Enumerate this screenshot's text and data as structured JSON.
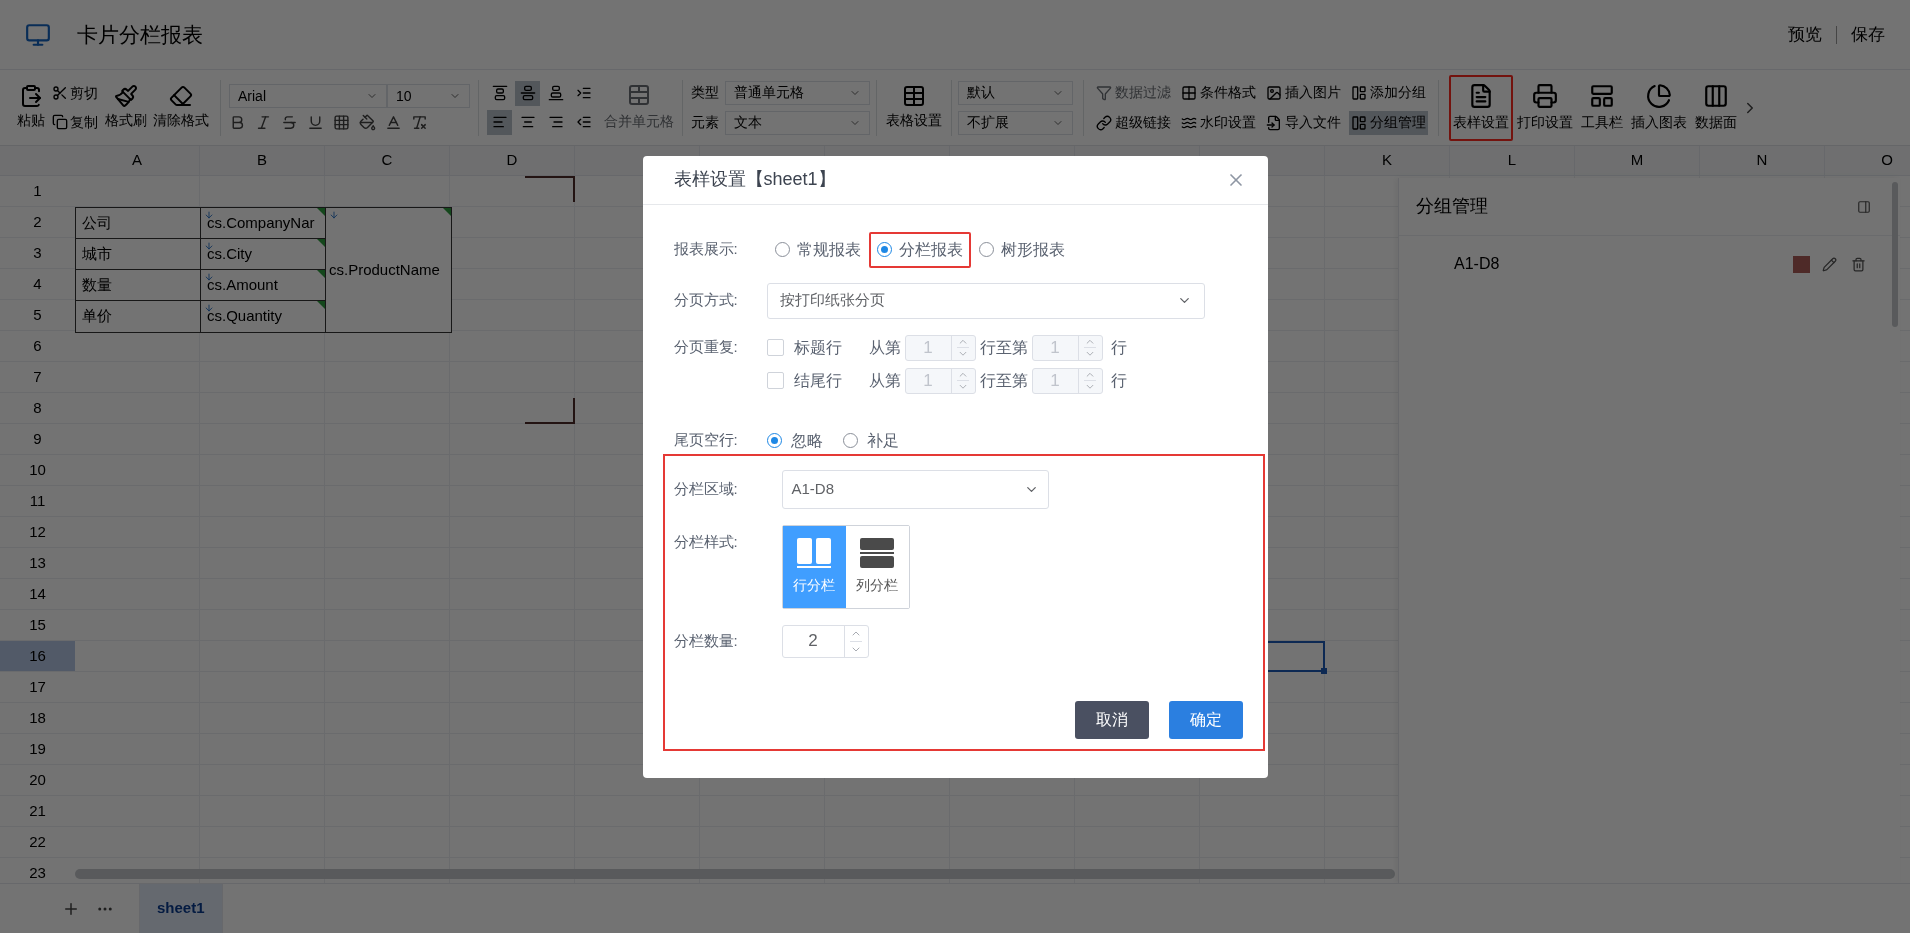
{
  "app": {
    "title": "卡片分栏报表",
    "actions": [
      "预览",
      "保存"
    ]
  },
  "toolbar": {
    "clipboard": {
      "paste": "粘贴",
      "cut": "剪切",
      "copy": "复制",
      "format_painter": "格式刷",
      "clear_format": "清除格式"
    },
    "font": {
      "family": "Arial",
      "size": "10"
    },
    "format_buttons": [
      {
        "kind": "bold"
      },
      {
        "kind": "italic"
      },
      {
        "kind": "strike"
      },
      {
        "kind": "underline"
      },
      {
        "kind": "border"
      },
      {
        "kind": "fill"
      },
      {
        "kind": "color"
      },
      {
        "kind": "clear"
      }
    ],
    "align_buttons": [
      {
        "kind": "top",
        "selected": false
      },
      {
        "kind": "middle",
        "selected": true
      },
      {
        "kind": "bottom",
        "selected": false
      },
      {
        "kind": "indent",
        "selected": false
      },
      {
        "kind": "left",
        "selected": true
      },
      {
        "kind": "center",
        "selected": false
      },
      {
        "kind": "right",
        "selected": false
      },
      {
        "kind": "outdent",
        "selected": false
      }
    ],
    "merge": {
      "label": "合并单元格",
      "disabled": true
    },
    "cell": [
      {
        "label": "类型",
        "value": "普通单元格"
      },
      {
        "label": "元素",
        "value": "文本"
      }
    ],
    "table_settings": "表格设置",
    "expand": [
      "默认",
      "不扩展"
    ],
    "tools": [
      {
        "label": "数据过滤",
        "kind": "filter",
        "disabled": true,
        "selected": false
      },
      {
        "label": "条件格式",
        "kind": "grid",
        "disabled": false,
        "selected": false
      },
      {
        "label": "插入图片",
        "kind": "image",
        "disabled": false,
        "selected": false
      },
      {
        "label": "添加分组",
        "kind": "group",
        "disabled": false,
        "selected": false
      },
      {
        "label": "超级链接",
        "kind": "link",
        "disabled": false,
        "selected": false
      },
      {
        "label": "水印设置",
        "kind": "watermark",
        "disabled": false,
        "selected": false
      },
      {
        "label": "导入文件",
        "kind": "import",
        "disabled": false,
        "selected": false
      },
      {
        "label": "分组管理",
        "kind": "group",
        "disabled": false,
        "selected": true
      }
    ],
    "big_tools": [
      {
        "label": "表样设置",
        "kind": "doc",
        "highlighted": true
      },
      {
        "label": "打印设置",
        "kind": "printer",
        "highlighted": false
      },
      {
        "label": "工具栏",
        "kind": "panel",
        "highlighted": false
      },
      {
        "label": "插入图表",
        "kind": "pie",
        "highlighted": false
      },
      {
        "label": "数据面",
        "kind": "columns",
        "highlighted": false
      }
    ]
  },
  "sheet": {
    "columns_left": [
      "A",
      "B",
      "C",
      "D"
    ],
    "columns_right": [
      "K",
      "L",
      "M",
      "N",
      "O"
    ],
    "rows": [
      {
        "label": "1",
        "selected": false
      },
      {
        "label": "2",
        "selected": false
      },
      {
        "label": "3",
        "selected": false
      },
      {
        "label": "4",
        "selected": false
      },
      {
        "label": "5",
        "selected": false
      },
      {
        "label": "6",
        "selected": false
      },
      {
        "label": "7",
        "selected": false
      },
      {
        "label": "8",
        "selected": false
      },
      {
        "label": "9",
        "selected": false
      },
      {
        "label": "10",
        "selected": false
      },
      {
        "label": "11",
        "selected": false
      },
      {
        "label": "12",
        "selected": false
      },
      {
        "label": "13",
        "selected": false
      },
      {
        "label": "14",
        "selected": false
      },
      {
        "label": "15",
        "selected": false
      },
      {
        "label": "16",
        "selected": true
      },
      {
        "label": "17",
        "selected": false
      },
      {
        "label": "18",
        "selected": false
      },
      {
        "label": "19",
        "selected": false
      },
      {
        "label": "20",
        "selected": false
      },
      {
        "label": "21",
        "selected": false
      },
      {
        "label": "22",
        "selected": false
      },
      {
        "label": "23",
        "selected": false
      }
    ],
    "data_table": {
      "rows": [
        {
          "label": "公司",
          "field": "cs.CompanyNar"
        },
        {
          "label": "城市",
          "field": "cs.City"
        },
        {
          "label": "数量",
          "field": "cs.Amount"
        },
        {
          "label": "单价",
          "field": "cs.Quantity"
        }
      ],
      "merged_field": "cs.ProductName"
    },
    "tabs": [
      {
        "label": "sheet1",
        "selected": true
      }
    ]
  },
  "group_panel": {
    "title": "分组管理",
    "groups": [
      {
        "range": "A1-D8",
        "color": "#4e2a28"
      }
    ]
  },
  "dialog": {
    "title": "表样设置【sheet1】",
    "display": {
      "label": "报表展示:",
      "options": [
        {
          "label": "常规报表",
          "selected": false,
          "highlighted": false
        },
        {
          "label": "分栏报表",
          "selected": true,
          "highlighted": true
        },
        {
          "label": "树形报表",
          "selected": false,
          "highlighted": false
        }
      ]
    },
    "paging": {
      "label": "分页方式:",
      "value": "按打印纸张分页"
    },
    "repeat": {
      "label": "分页重复:",
      "rows": [
        {
          "label": "标题行",
          "checked": false,
          "from_label": "从第",
          "from": "1",
          "to_label": "行至第",
          "to": "1",
          "unit": "行"
        },
        {
          "label": "结尾行",
          "checked": false,
          "from_label": "从第",
          "from": "1",
          "to_label": "行至第",
          "to": "1",
          "unit": "行"
        }
      ]
    },
    "tail": {
      "label": "尾页空行:",
      "options": [
        {
          "label": "忽略",
          "selected": true
        },
        {
          "label": "补足",
          "selected": false
        }
      ]
    },
    "columns_section": {
      "highlighted": true,
      "area": {
        "label": "分栏区域:",
        "value": "A1-D8"
      },
      "style": {
        "label": "分栏样式:",
        "options": [
          {
            "label": "行分栏",
            "kind": "row",
            "selected": true
          },
          {
            "label": "列分栏",
            "kind": "column",
            "selected": false
          }
        ]
      },
      "count": {
        "label": "分栏数量:",
        "value": "2"
      }
    },
    "buttons": [
      {
        "label": "取消",
        "kind": "secondary"
      },
      {
        "label": "确定",
        "kind": "primary"
      }
    ]
  }
}
